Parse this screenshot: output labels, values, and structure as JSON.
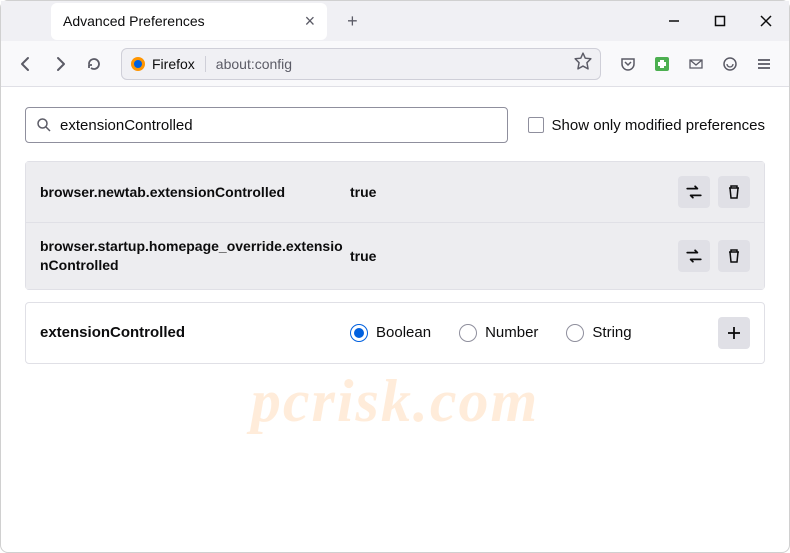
{
  "window": {
    "tab_title": "Advanced Preferences",
    "address_prefix": "Firefox",
    "address_url": "about:config"
  },
  "search": {
    "value": "extensionControlled",
    "checkbox_label": "Show only modified preferences"
  },
  "prefs": [
    {
      "name": "browser.newtab.extensionControlled",
      "value": "true"
    },
    {
      "name": "browser.startup.homepage_override.extensionControlled",
      "value": "true"
    }
  ],
  "create": {
    "name": "extensionControlled",
    "options": [
      "Boolean",
      "Number",
      "String"
    ],
    "selected": "Boolean"
  },
  "watermark": "pcrisk.com"
}
